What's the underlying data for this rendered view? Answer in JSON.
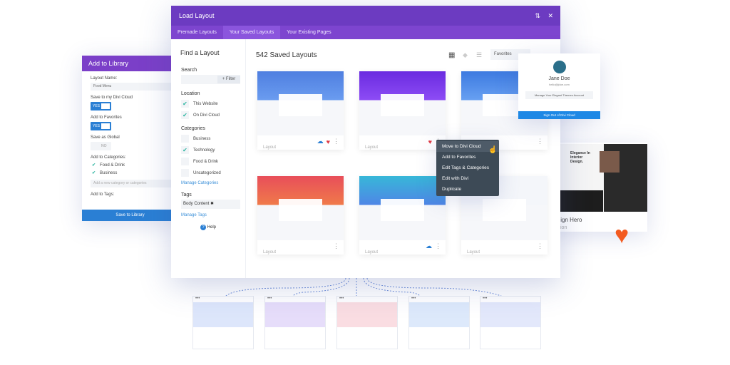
{
  "library": {
    "title": "Add to Library",
    "layout_name_label": "Layout Name:",
    "layout_name_value": "Food Menu",
    "save_cloud_label": "Save to my Divi Cloud",
    "save_cloud_value": "YES",
    "favorites_label": "Add to Favorites",
    "favorites_value": "YES",
    "global_label": "Save as Global",
    "global_value": "NO",
    "categories_label": "Add to Categories:",
    "categories": [
      "Food & Drink",
      "Business"
    ],
    "category_placeholder": "Add a new category or categories",
    "tags_label": "Add to Tags:",
    "save_button": "Save to Library"
  },
  "modal": {
    "title": "Load Layout",
    "tabs": [
      "Premade Layouts",
      "Your Saved Layouts",
      "Your Existing Pages"
    ],
    "active_tab": 1
  },
  "sidebar": {
    "title": "Find a Layout",
    "search_label": "Search",
    "filter_button": "+ Filter",
    "location_label": "Location",
    "locations": [
      "This Website",
      "On Divi Cloud"
    ],
    "categories_label": "Categories",
    "categories": [
      {
        "label": "Business",
        "checked": false
      },
      {
        "label": "Technology",
        "checked": true
      },
      {
        "label": "Food & Drink",
        "checked": false
      },
      {
        "label": "Uncategorized",
        "checked": false
      }
    ],
    "manage_categories": "Manage Categories",
    "tags_label": "Tags",
    "tag": "Body Content",
    "manage_tags": "Manage Tags",
    "help": "Help"
  },
  "main": {
    "count_title": "542 Saved Layouts",
    "filter_select": "Favorites",
    "cards": [
      {
        "name": "",
        "type": "Layout",
        "cloud": true,
        "favorite": true,
        "colors": [
          "#4f7fe0",
          "#6a9cf0"
        ]
      },
      {
        "name": "",
        "type": "Layout",
        "cloud": false,
        "favorite": true,
        "colors": [
          "#6a2be0",
          "#8d4cf5"
        ]
      },
      {
        "name": "",
        "type": "Layout",
        "cloud": false,
        "favorite": false,
        "colors": [
          "#3d7ae0",
          "#67a0f2"
        ]
      },
      {
        "name": "",
        "type": "Layout",
        "cloud": false,
        "favorite": false,
        "colors": [
          "#e84e5a",
          "#f07a4a"
        ]
      },
      {
        "name": "",
        "type": "Layout",
        "cloud": true,
        "favorite": false,
        "colors": [
          "#37b7d8",
          "#4f86e6"
        ]
      },
      {
        "name": "",
        "type": "Layout",
        "cloud": false,
        "favorite": false,
        "colors": [
          "#f4f6fa",
          "#f4f6fa"
        ]
      }
    ]
  },
  "context_menu": [
    "Move to Divi Cloud",
    "Add to Favorites",
    "Edit Tags & Categories",
    "Edit with Divi",
    "Duplicate"
  ],
  "profile": {
    "name": "Jane Doe",
    "email": "hello@jdoe.com",
    "manage_button": "Manage Your Elegant Themes Account",
    "sign_out_button": "Sign Out of Divi Cloud"
  },
  "right_card": {
    "headline": "Elegance In Interior Design.",
    "name": "Design Hero",
    "type": "Section"
  },
  "colors": {
    "purple": "#6c3bc1",
    "blue": "#2a7fd4",
    "heart": "#f35a1f",
    "check": "#2bb5a0"
  }
}
